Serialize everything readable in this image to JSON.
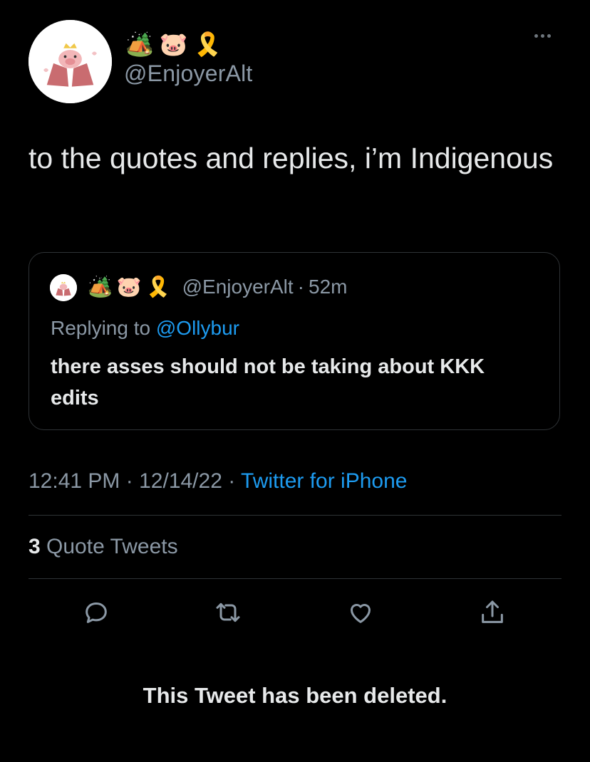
{
  "header": {
    "emojis": [
      "🏕️",
      "🐷",
      "🎗️"
    ],
    "handle": "@EnjoyerAlt"
  },
  "tweet": {
    "text": "to the quotes and replies, i’m Indigenous"
  },
  "quote": {
    "emojis": [
      "🏕️",
      "🐷",
      "🎗️"
    ],
    "handle": "@EnjoyerAlt",
    "separator": "·",
    "time": "52m",
    "replying_prefix": "Replying to",
    "replying_to": "@Ollybur",
    "text": "there asses should not be taking about KKK edits"
  },
  "meta": {
    "time": "12:41 PM",
    "sep1": "·",
    "date": "12/14/22",
    "sep2": "·",
    "source": "Twitter for iPhone"
  },
  "stats": {
    "quote_count": "3",
    "quote_label": "Quote Tweets"
  },
  "actions": {
    "icons": [
      "reply-icon",
      "retweet-icon",
      "like-icon",
      "share-icon"
    ]
  },
  "footer": {
    "deleted_notice": "This Tweet has been deleted."
  },
  "colors": {
    "background": "#000000",
    "text": "#e7e9ea",
    "secondary": "#8b98a5",
    "link": "#1d9bf0",
    "border": "#2f3336"
  }
}
